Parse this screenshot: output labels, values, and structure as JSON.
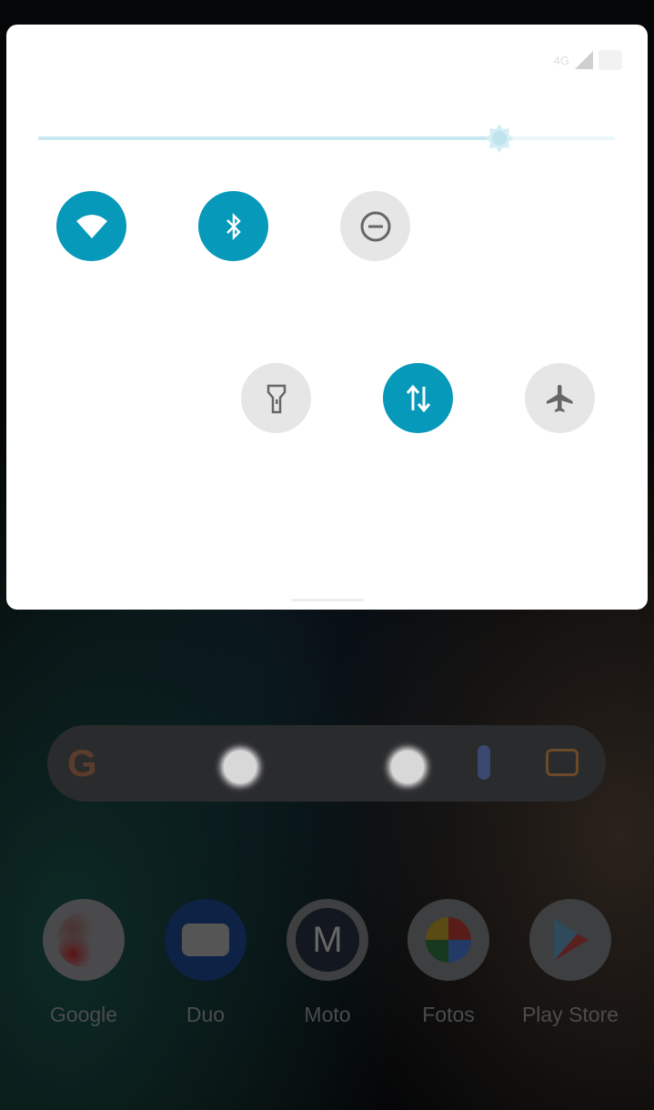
{
  "status": {
    "network": "4G",
    "signal_icon": "signal-icon",
    "battery_icon": "battery-icon"
  },
  "brightness": {
    "level": 0.8
  },
  "tiles": [
    {
      "name": "wifi",
      "icon": "wifi-icon",
      "active": true
    },
    {
      "name": "bluetooth",
      "icon": "bluetooth-icon",
      "active": true
    },
    {
      "name": "do-not-disturb",
      "icon": "do-not-disturb-icon",
      "active": false
    },
    {
      "name": "flashlight",
      "icon": "flashlight-icon",
      "active": false
    },
    {
      "name": "mobile-data",
      "icon": "mobile-data-icon",
      "active": true
    },
    {
      "name": "airplane-mode",
      "icon": "airplane-icon",
      "active": false
    }
  ],
  "colors": {
    "accent": "#0699b9",
    "inactive": "#e6e6e6"
  },
  "dock": [
    {
      "label": "Google"
    },
    {
      "label": "Duo"
    },
    {
      "label": "Moto"
    },
    {
      "label": "Fotos"
    },
    {
      "label": "Play Store"
    }
  ]
}
